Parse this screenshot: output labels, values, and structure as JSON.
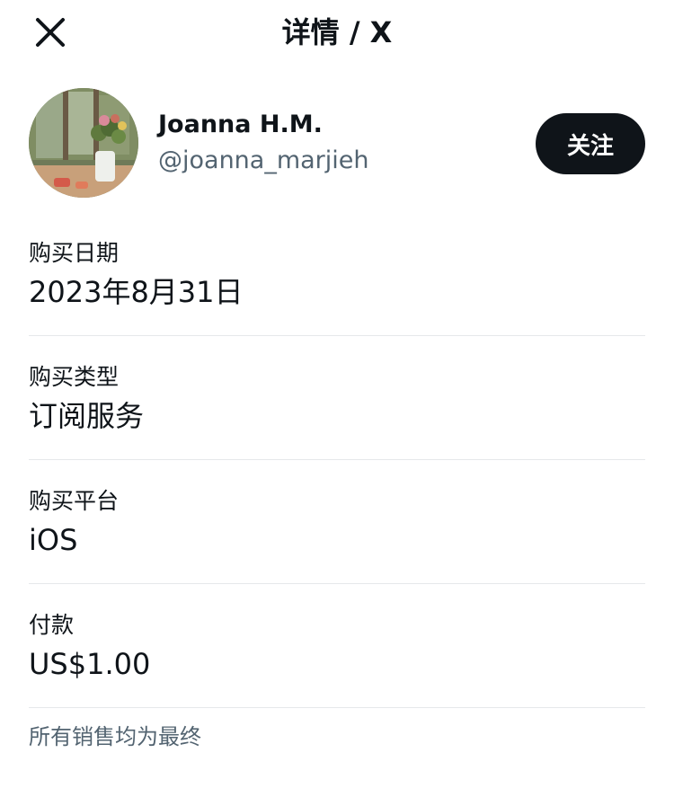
{
  "header": {
    "title": "详情 / X",
    "close_icon": "close-icon"
  },
  "profile": {
    "name": "Joanna H.M.",
    "handle": "@joanna_marjieh",
    "follow_label": "关注",
    "follow_bg": "#0f1419"
  },
  "details": [
    {
      "label": "购买日期",
      "value": "2023年8月31日"
    },
    {
      "label": "购买类型",
      "value": "订阅服务"
    },
    {
      "label": "购买平台",
      "value": "iOS"
    },
    {
      "label": "付款",
      "value": "US$1.00"
    }
  ],
  "footer": {
    "note": "所有销售均为最终"
  },
  "colors": {
    "text_primary": "#0f1419",
    "text_secondary": "#536471",
    "divider": "#e6e8ea"
  }
}
